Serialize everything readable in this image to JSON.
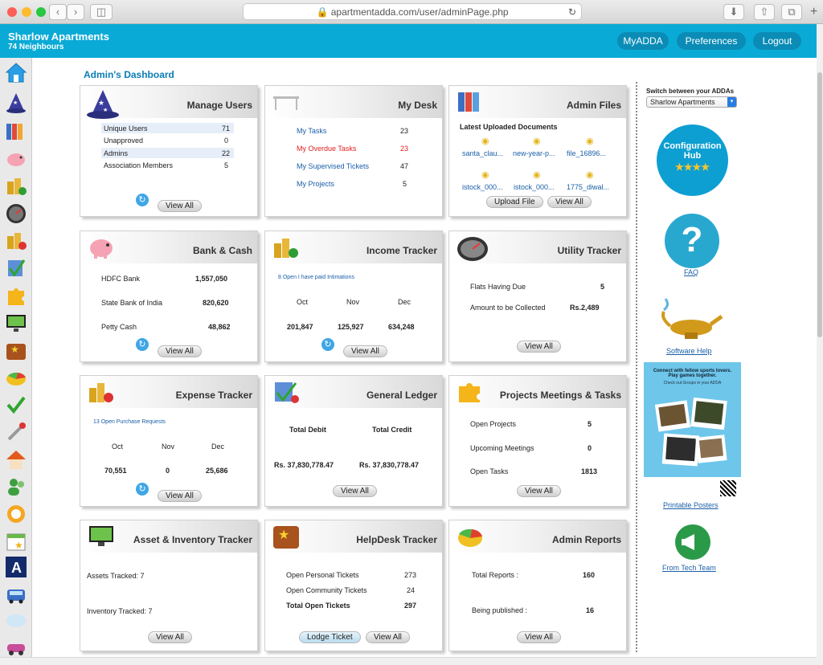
{
  "browser": {
    "url": "apartmentadda.com/user/adminPage.php"
  },
  "header": {
    "apt_name": "Sharlow Apartments",
    "neighbours": "74 Neighbours",
    "nav": [
      "MyADDA",
      "Preferences",
      "Logout"
    ]
  },
  "dashboard_title": "Admin's Dashboard",
  "common": {
    "view_all": "View All"
  },
  "manage_users": {
    "title": "Manage Users",
    "rows": [
      {
        "label": "Unique Users",
        "value": "71"
      },
      {
        "label": "Unapproved",
        "value": "0"
      },
      {
        "label": "Admins",
        "value": "22"
      },
      {
        "label": "Association Members",
        "value": "5"
      }
    ]
  },
  "my_desk": {
    "title": "My Desk",
    "rows": [
      {
        "label": "My Tasks",
        "value": "23"
      },
      {
        "label": "My Overdue Tasks",
        "value": "23"
      },
      {
        "label": "My Supervised Tickets",
        "value": "47"
      },
      {
        "label": "My Projects",
        "value": "5"
      }
    ]
  },
  "admin_files": {
    "title": "Admin Files",
    "subtitle": "Latest Uploaded Documents",
    "files": [
      "santa_clau...",
      "new-year-p...",
      "file_16896...",
      "istock_000...",
      "istock_000...",
      "1775_diwal..."
    ],
    "upload_label": "Upload File"
  },
  "bank_cash": {
    "title": "Bank & Cash",
    "rows": [
      {
        "label": "HDFC Bank",
        "value": "1,557,050"
      },
      {
        "label": "State Bank of India",
        "value": "820,620"
      },
      {
        "label": "Petty Cash",
        "value": "48,862"
      }
    ]
  },
  "income_tracker": {
    "title": "Income Tracker",
    "link": "8 Open I have paid Intimations",
    "months": [
      "Oct",
      "Nov",
      "Dec"
    ],
    "values": [
      "201,847",
      "125,927",
      "634,248"
    ]
  },
  "utility_tracker": {
    "title": "Utility Tracker",
    "rows": [
      {
        "label": "Flats Having Due",
        "value": "5"
      },
      {
        "label": "Amount to be Collected",
        "value": "Rs.2,489"
      }
    ]
  },
  "expense_tracker": {
    "title": "Expense Tracker",
    "link": "13 Open Purchase Requests",
    "months": [
      "Oct",
      "Nov",
      "Dec"
    ],
    "values": [
      "70,551",
      "0",
      "25,686"
    ]
  },
  "general_ledger": {
    "title": "General Ledger",
    "debit_label": "Total Debit",
    "credit_label": "Total Credit",
    "debit_value": "Rs. 37,830,778.47",
    "credit_value": "Rs. 37,830,778.47"
  },
  "projects_meetings": {
    "title": "Projects Meetings & Tasks",
    "rows": [
      {
        "label": "Open Projects",
        "value": "5"
      },
      {
        "label": "Upcoming Meetings",
        "value": "0"
      },
      {
        "label": "Open Tasks",
        "value": "1813"
      }
    ]
  },
  "asset_tracker": {
    "title": "Asset & Inventory Tracker",
    "rows": [
      "Assets Tracked: 7",
      "Inventory Tracked: 7"
    ]
  },
  "helpdesk": {
    "title": "HelpDesk Tracker",
    "rows": [
      {
        "label": "Open Personal Tickets",
        "value": "273"
      },
      {
        "label": "Open Community Tickets",
        "value": "24"
      },
      {
        "label": "Total Open Tickets",
        "value": "297"
      }
    ],
    "lodge_label": "Lodge Ticket"
  },
  "admin_reports": {
    "title": "Admin Reports",
    "rows": [
      {
        "label": "Total Reports :",
        "value": "160"
      },
      {
        "label": "Being published :",
        "value": "16"
      }
    ]
  },
  "right_panel": {
    "switch_label": "Switch between your ADDAs",
    "switch_value": "Sharlow Apartments",
    "config_hub_line1": "Configuration",
    "config_hub_line2": "Hub",
    "stars": "★★★★",
    "faq": "FAQ",
    "software_help": "Software Help",
    "poster_line1": "Connect with fellow sports lovers.",
    "poster_line2": "Play games together.",
    "poster_line3": "Check out Groups in your ADDA",
    "printable_posters": "Printable Posters",
    "from_tech_team": "From Tech Team"
  }
}
